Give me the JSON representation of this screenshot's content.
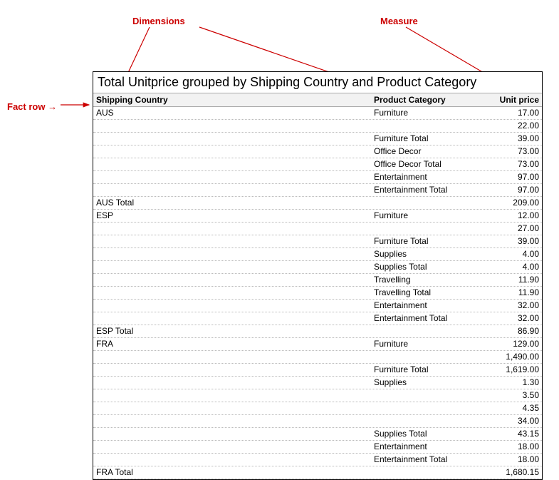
{
  "annotations": {
    "dimensions": "Dimensions",
    "measure": "Measure",
    "fact_row": "Fact row"
  },
  "report": {
    "title": "Total Unitprice grouped by Shipping Country and Product Category",
    "headers": {
      "country": "Shipping Country",
      "category": "Product Category",
      "price": "Unit price"
    },
    "rows": [
      {
        "country": "AUS",
        "category": "Furniture",
        "price": "17.00"
      },
      {
        "country": "",
        "category": "",
        "price": "22.00"
      },
      {
        "country": "",
        "category": "Furniture Total",
        "price": "39.00"
      },
      {
        "country": "",
        "category": "Office Decor",
        "price": "73.00"
      },
      {
        "country": "",
        "category": "Office Decor Total",
        "price": "73.00"
      },
      {
        "country": "",
        "category": "Entertainment",
        "price": "97.00"
      },
      {
        "country": "",
        "category": "Entertainment Total",
        "price": "97.00"
      },
      {
        "country": "AUS Total",
        "category": "",
        "price": "209.00"
      },
      {
        "country": "ESP",
        "category": "Furniture",
        "price": "12.00"
      },
      {
        "country": "",
        "category": "",
        "price": "27.00"
      },
      {
        "country": "",
        "category": "Furniture Total",
        "price": "39.00"
      },
      {
        "country": "",
        "category": "Supplies",
        "price": "4.00"
      },
      {
        "country": "",
        "category": "Supplies Total",
        "price": "4.00"
      },
      {
        "country": "",
        "category": "Travelling",
        "price": "11.90"
      },
      {
        "country": "",
        "category": "Travelling Total",
        "price": "11.90"
      },
      {
        "country": "",
        "category": "Entertainment",
        "price": "32.00"
      },
      {
        "country": "",
        "category": "Entertainment Total",
        "price": "32.00"
      },
      {
        "country": "ESP Total",
        "category": "",
        "price": "86.90"
      },
      {
        "country": "FRA",
        "category": "Furniture",
        "price": "129.00"
      },
      {
        "country": "",
        "category": "",
        "price": "1,490.00"
      },
      {
        "country": "",
        "category": "Furniture Total",
        "price": "1,619.00"
      },
      {
        "country": "",
        "category": "Supplies",
        "price": "1.30"
      },
      {
        "country": "",
        "category": "",
        "price": "3.50"
      },
      {
        "country": "",
        "category": "",
        "price": "4.35"
      },
      {
        "country": "",
        "category": "",
        "price": "34.00"
      },
      {
        "country": "",
        "category": "Supplies Total",
        "price": "43.15"
      },
      {
        "country": "",
        "category": "Entertainment",
        "price": "18.00"
      },
      {
        "country": "",
        "category": "Entertainment Total",
        "price": "18.00"
      },
      {
        "country": "FRA Total",
        "category": "",
        "price": "1,680.15"
      }
    ]
  }
}
